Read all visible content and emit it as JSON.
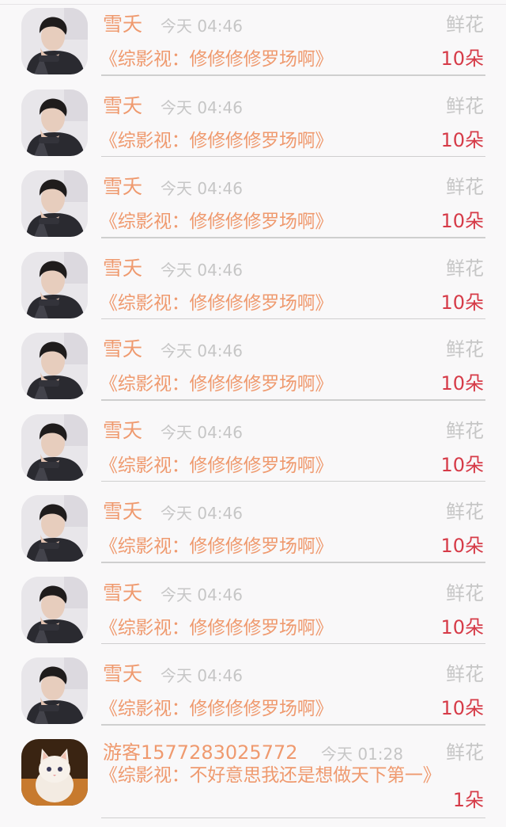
{
  "gift_rows": [
    {
      "user": "雪夭",
      "time": "今天 04:46",
      "gift_label": "鲜花",
      "title": "《综影视：修修修修罗场啊》",
      "count": "10朵"
    },
    {
      "user": "雪夭",
      "time": "今天 04:46",
      "gift_label": "鲜花",
      "title": "《综影视：修修修修罗场啊》",
      "count": "10朵"
    },
    {
      "user": "雪夭",
      "time": "今天 04:46",
      "gift_label": "鲜花",
      "title": "《综影视：修修修修罗场啊》",
      "count": "10朵"
    },
    {
      "user": "雪夭",
      "time": "今天 04:46",
      "gift_label": "鲜花",
      "title": "《综影视：修修修修罗场啊》",
      "count": "10朵"
    },
    {
      "user": "雪夭",
      "time": "今天 04:46",
      "gift_label": "鲜花",
      "title": "《综影视：修修修修罗场啊》",
      "count": "10朵"
    },
    {
      "user": "雪夭",
      "time": "今天 04:46",
      "gift_label": "鲜花",
      "title": "《综影视：修修修修罗场啊》",
      "count": "10朵"
    },
    {
      "user": "雪夭",
      "time": "今天 04:46",
      "gift_label": "鲜花",
      "title": "《综影视：修修修修罗场啊》",
      "count": "10朵"
    },
    {
      "user": "雪夭",
      "time": "今天 04:46",
      "gift_label": "鲜花",
      "title": "《综影视：修修修修罗场啊》",
      "count": "10朵"
    },
    {
      "user": "雪夭",
      "time": "今天 04:46",
      "gift_label": "鲜花",
      "title": "《综影视：修修修修罗场啊》",
      "count": "10朵"
    }
  ],
  "last_row": {
    "user": "游客1577283025772",
    "time": "今天 01:28",
    "gift_label": "鲜花",
    "title": "《综影视：不好意思我还是想做天下第一》",
    "count": "1朵"
  },
  "colors": {
    "name": "#ef9a6f",
    "count": "#d63b48",
    "muted": "#c6c6c6"
  },
  "icons": {
    "user_avatar": "man-portrait-avatar",
    "guest_avatar": "kitten-avatar"
  }
}
